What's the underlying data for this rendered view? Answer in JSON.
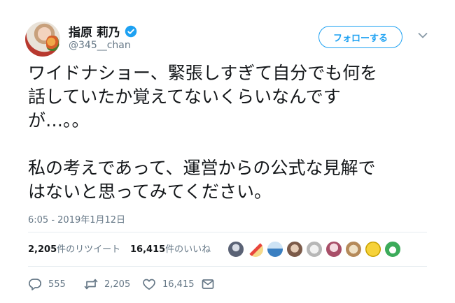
{
  "author": {
    "display_name": "指原 莉乃",
    "handle": "@345__chan",
    "verified": true
  },
  "follow_button": {
    "label": "フォローする"
  },
  "tweet": {
    "text": "ワイドナショー、緊張しすぎて自分でも何を\n話していたか覚えてないくらいなんです\nが…。。\n\n私の考えであって、運営からの公式な見解で\nはないと思ってみてください。",
    "timestamp": "6:05 - 2019年1月12日"
  },
  "stats": {
    "retweet_count": "2,205",
    "retweet_label": "件のリツイート",
    "like_count": "16,415",
    "like_label": "件のいいね"
  },
  "actions": {
    "reply_count": "555",
    "retweet_count": "2,205",
    "like_count": "16,415"
  },
  "colors": {
    "accent": "#1da1f2",
    "text": "#14171a",
    "secondary_text": "#657786",
    "divider": "#e6ecf0"
  },
  "icons": [
    "verified-icon",
    "chevron-down-icon",
    "reply-icon",
    "retweet-icon",
    "heart-icon",
    "dm-icon"
  ]
}
